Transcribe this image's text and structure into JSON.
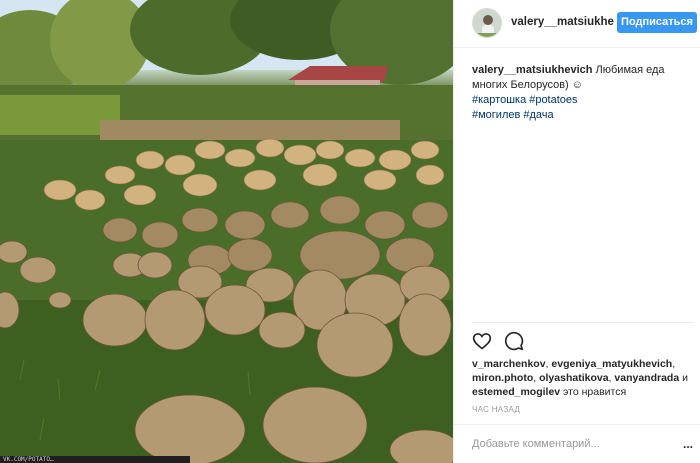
{
  "post": {
    "username": "valery__matsiukhe",
    "follow_label": "Подписаться",
    "caption": {
      "username": "valery__matsiukhevich",
      "text": "Любимая еда многих Белорусов)",
      "emoji": "☺",
      "hashtags": [
        "#картошка",
        "#potatoes",
        "#могилев",
        "#дача"
      ]
    },
    "likes": {
      "users": [
        "v_marchenkov",
        "evgeniya_matyukhevich",
        "miron.photo",
        "olyashatikova",
        "vanyandrada",
        "estemed_mogilev"
      ],
      "and_word": "и",
      "suffix": "это нравится"
    },
    "timestamp": "ЧАС НАЗАД",
    "comment_placeholder": "Добавьте комментарий...",
    "more_label": "..."
  },
  "photo": {
    "caption_strip": "VK.COM/POTATO…"
  },
  "icons": {
    "like": "heart-icon",
    "comment": "comment-icon",
    "more": "ellipsis-icon"
  },
  "colors": {
    "follow_button": "#3897f0",
    "hashtag": "#003569",
    "muted_text": "#999999"
  }
}
